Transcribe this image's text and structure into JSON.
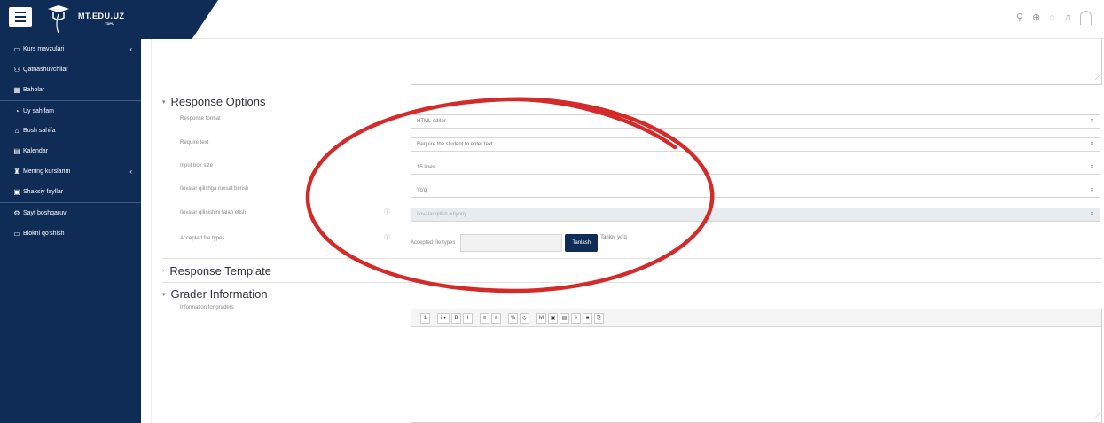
{
  "brand": {
    "name": "MT.EDU.UZ",
    "sub": "TDPU"
  },
  "sidebar": {
    "items": [
      {
        "label": "Kurs mavzulari",
        "icon": "folder-icon",
        "glyph": "▭",
        "chevron": "‹"
      },
      {
        "label": "Qatnashuvchilar",
        "icon": "users-icon",
        "glyph": "⚇",
        "chevron": ""
      },
      {
        "label": "Baholar",
        "icon": "grades-icon",
        "glyph": "▦",
        "chevron": ""
      },
      {
        "label": "Uy sahifam",
        "icon": "dashboard-icon",
        "glyph": "◔",
        "chevron": ""
      },
      {
        "label": "Bosh sahifa",
        "icon": "home-icon",
        "glyph": "⌂",
        "chevron": ""
      },
      {
        "label": "Kalendar",
        "icon": "calendar-icon",
        "glyph": "▤",
        "chevron": ""
      },
      {
        "label": "Mening kurslarim",
        "icon": "graduation-cap-icon",
        "glyph": "♜",
        "chevron": "‹"
      },
      {
        "label": "Shaxsiy fayllar",
        "icon": "files-icon",
        "glyph": "▣",
        "chevron": ""
      },
      {
        "label": "Sayt boshqaruvi",
        "icon": "settings-icon",
        "glyph": "⚙",
        "chevron": ""
      },
      {
        "label": "Blokni qo'shish",
        "icon": "add-block-icon",
        "glyph": "▭",
        "chevron": ""
      }
    ]
  },
  "response_options": {
    "title": "Response Options",
    "fields": [
      {
        "label": "Response format",
        "value": "HTML editor"
      },
      {
        "label": "Require text",
        "value": "Require the student to enter text"
      },
      {
        "label": "Input box size",
        "value": "15 lines"
      },
      {
        "label": "Ilovalar qilishga ruxsat berish",
        "value": "Yo'q"
      },
      {
        "label": "Ilovalar qilinishini talab etish",
        "value": "Ilovalar qilish ixtiyoriy"
      }
    ],
    "accepted": {
      "label": "Accepted file types",
      "inline_label": "Accepted file types",
      "button": "Tanlash",
      "none_text": "Tanlov yo'q"
    }
  },
  "response_template": {
    "title": "Response Template"
  },
  "grader_info": {
    "title": "Grader Information",
    "label": "Information for graders"
  },
  "editor_buttons": [
    "1",
    "i ▾",
    "B",
    "I",
    "≡",
    "≡",
    "%",
    "⦸",
    "M",
    "▣",
    "▤",
    "⇩",
    "■",
    "⎘"
  ],
  "colors": {
    "navy": "#0f2c57",
    "annotation_red": "#d42a2a"
  }
}
